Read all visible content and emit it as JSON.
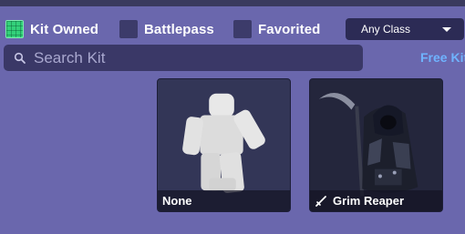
{
  "filters": {
    "kit_owned": {
      "label": "Kit Owned",
      "checked": true
    },
    "battlepass": {
      "label": "Battlepass",
      "checked": false
    },
    "favorited": {
      "label": "Favorited",
      "checked": false
    }
  },
  "class_select": {
    "value": "Any Class"
  },
  "search": {
    "placeholder": "Search Kit",
    "value": ""
  },
  "free_kit_label": "Free Kit",
  "kits": [
    {
      "name": "None",
      "icon": "none"
    },
    {
      "name": "Grim Reaper",
      "icon": "sword-icon"
    }
  ],
  "colors": {
    "accent_green": "#33d17a",
    "background": "#6a67ad",
    "link_blue": "#6fb3ff"
  }
}
